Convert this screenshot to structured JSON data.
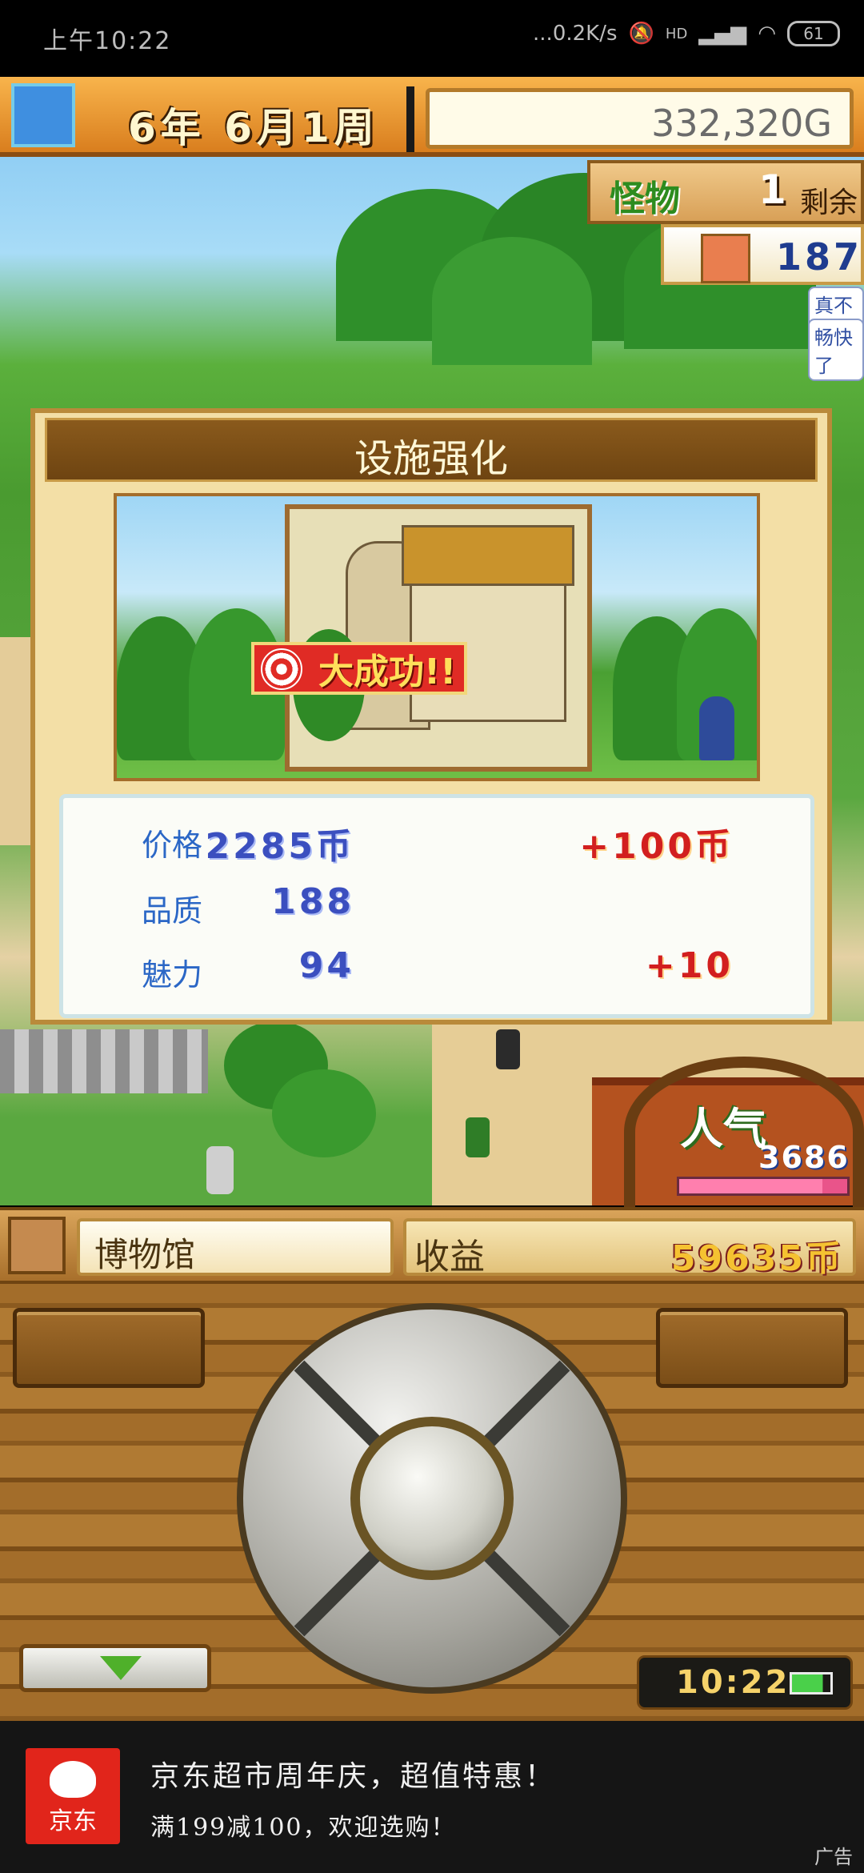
{
  "status_bar": {
    "time": "上午10:22",
    "network_speed": "...0.2K/s",
    "network_type": "HD",
    "battery": "61"
  },
  "hud": {
    "date": "6年 6月1周",
    "money": "332,320G",
    "monster_label": "怪物",
    "monster_count": "1",
    "monster_suffix": "剩余",
    "town_count": "187",
    "bubble_1": "真不甘",
    "bubble_2": "畅快了"
  },
  "dialog": {
    "title": "设施强化",
    "success_text": "大成功!!",
    "stats": [
      {
        "label": "价格",
        "value": "2285币",
        "bonus": "+100币"
      },
      {
        "label": "品质",
        "value": "188",
        "bonus": ""
      },
      {
        "label": "魅力",
        "value": "94",
        "bonus": "+10"
      }
    ]
  },
  "popularity": {
    "label": "人气",
    "value": "3686",
    "level": 0.85
  },
  "info_bar": {
    "facility_name": "博物馆",
    "income_label": "收益",
    "income_value": "59635币"
  },
  "controller": {
    "clock": "10:22",
    "battery_level": 0.8
  },
  "ad": {
    "logo_text": "京东",
    "line1": "京东超市周年庆，超值特惠！",
    "line2": "满199减100，欢迎选购！",
    "tag": "广告"
  },
  "colors": {
    "hud_orange": "#f8b44c",
    "wood_brown": "#8b5a1f",
    "dialog_parchment": "#f3dfa6",
    "stat_blue": "#3b4fbf",
    "bonus_red": "#d21f1f",
    "success_red": "#e02b25",
    "jd_red": "#e1251b"
  }
}
